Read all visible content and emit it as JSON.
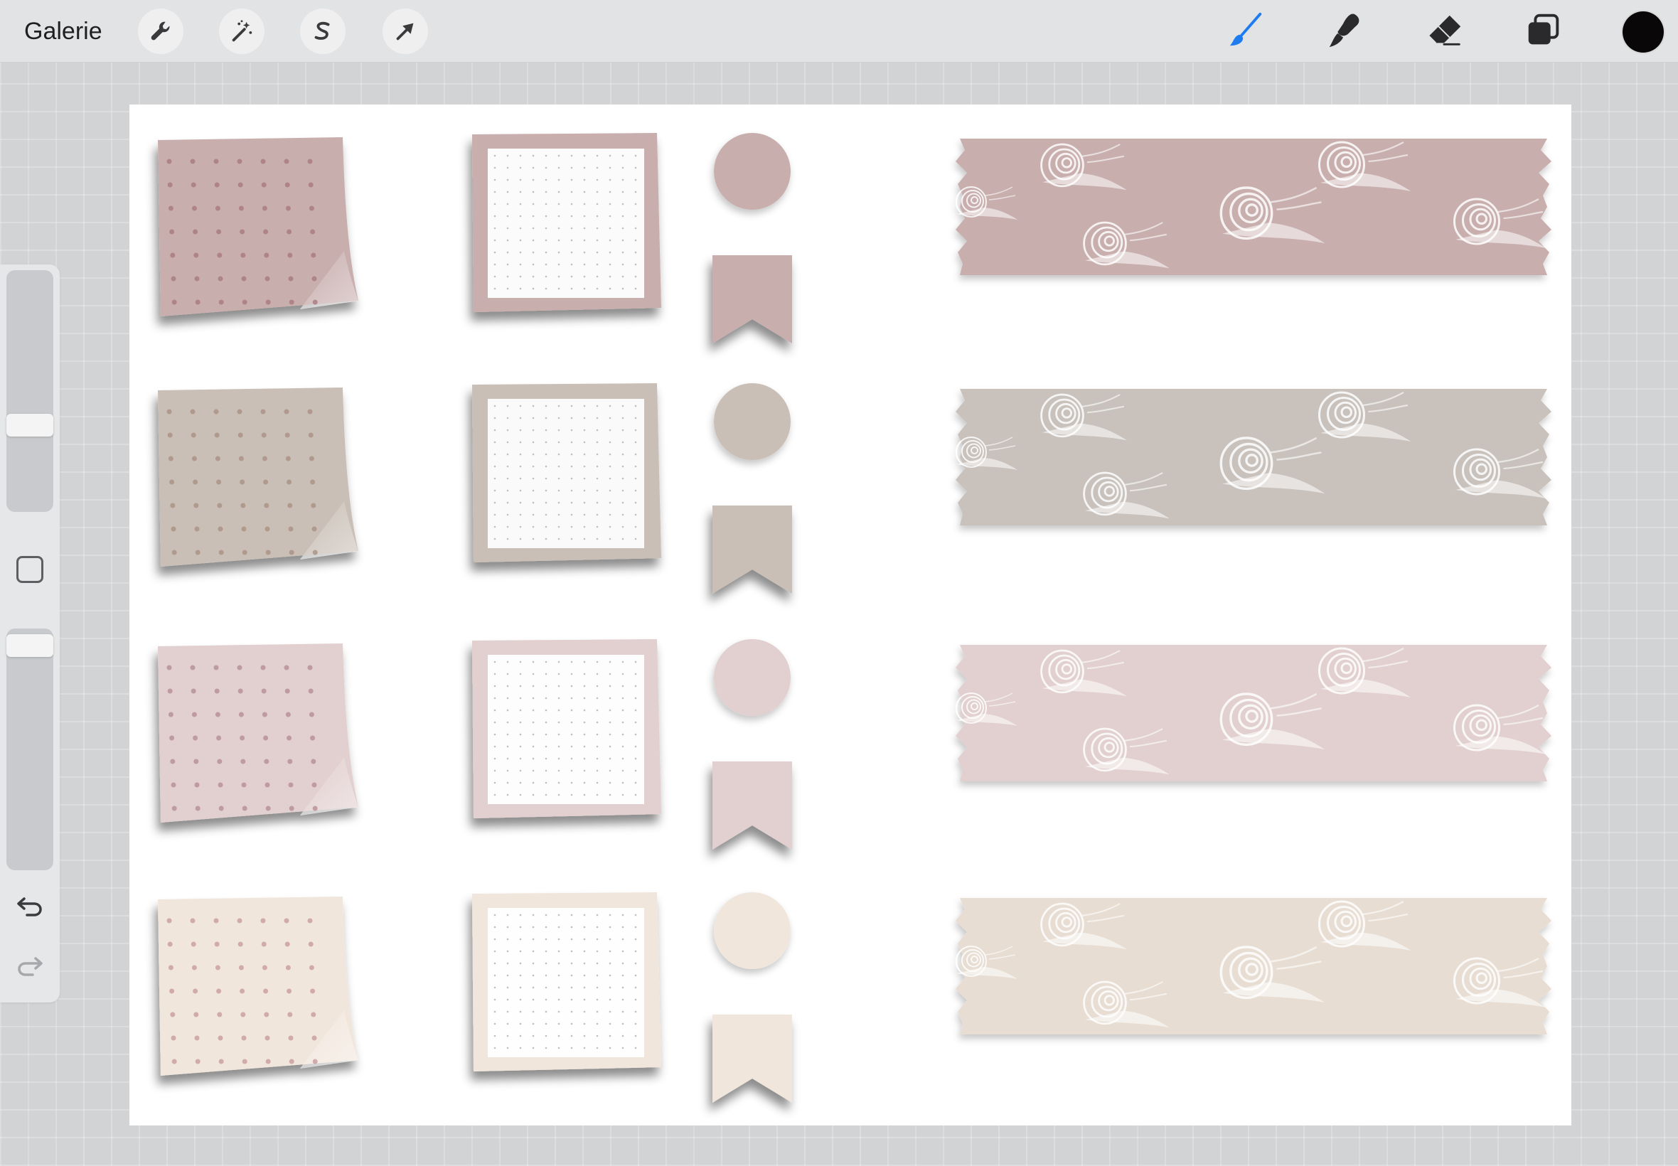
{
  "app": {
    "gallery_label": "Galerie"
  },
  "toolbar": {
    "left_tools": [
      {
        "name": "actions",
        "icon": "wrench-icon"
      },
      {
        "name": "adjustments",
        "icon": "magic-wand-icon"
      },
      {
        "name": "selection",
        "icon": "selection-s-icon"
      },
      {
        "name": "transform",
        "icon": "arrow-cursor-icon"
      }
    ],
    "right_tools": [
      {
        "name": "brush",
        "icon": "brush-icon",
        "active": true
      },
      {
        "name": "smudge",
        "icon": "smudge-icon",
        "active": false
      },
      {
        "name": "eraser",
        "icon": "eraser-icon",
        "active": false
      },
      {
        "name": "layers",
        "icon": "layers-icon",
        "active": false
      }
    ],
    "current_color": "#0a0708",
    "active_color": "#1e7cf0",
    "inactive_color": "#2a2a2c"
  },
  "sidebar": {
    "brush_size_level": 0.63,
    "opacity_level": 0.0
  },
  "palette": {
    "rows": [
      {
        "name": "mauve",
        "color": "#c9aeae",
        "dot": "#a4757b",
        "inner": "#fbfbfb"
      },
      {
        "name": "taupe",
        "color": "#c9bfb6",
        "dot": "#a78c7f",
        "inner": "#fafafa"
      },
      {
        "name": "blush",
        "color": "#e2cfcf",
        "dot": "#b28a8e",
        "inner": "#fdfdfd"
      },
      {
        "name": "cream",
        "color": "#f1e6dc",
        "dot": "#c4979a",
        "inner": "#fefefe"
      }
    ],
    "tape_colors": [
      "#c9aeae",
      "#c9c2bc",
      "#e2cfcf",
      "#e7ddd2"
    ]
  }
}
